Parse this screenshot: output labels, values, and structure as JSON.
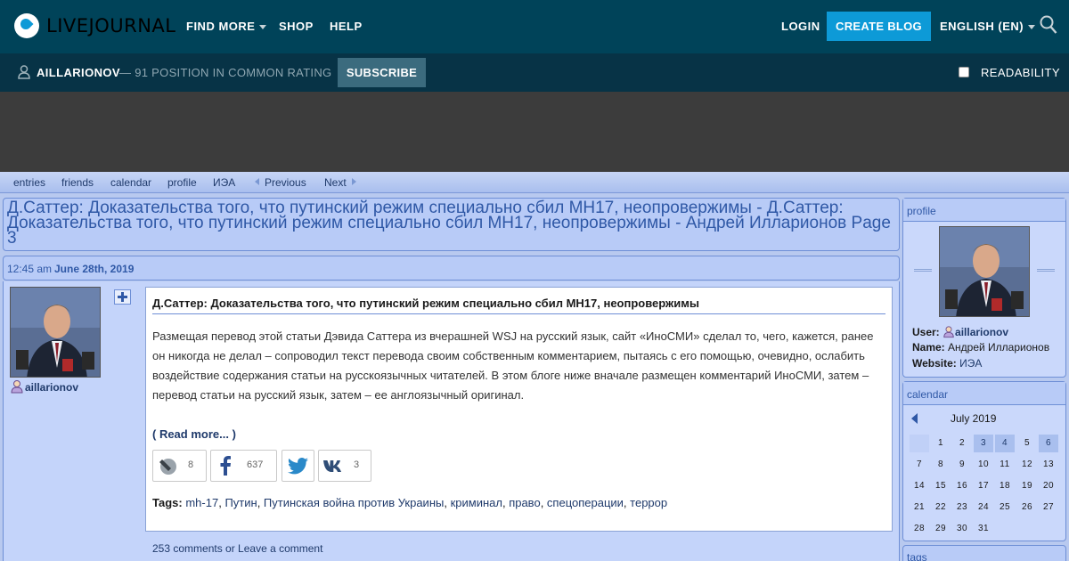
{
  "topbar": {
    "logo_text": "LIVEJOURNAL",
    "nav_find_more": "FIND MORE",
    "nav_shop": "SHOP",
    "nav_help": "HELP",
    "login": "LOGIN",
    "create_blog": "CREATE BLOG",
    "language": "ENGLISH (EN)"
  },
  "subbar": {
    "username": "AILLARIONOV",
    "rating": "— 91 POSITION IN COMMON RATING",
    "subscribe": "SUBSCRIBE",
    "readability": "READABILITY"
  },
  "journal_nav": {
    "entries": "entries",
    "friends": "friends",
    "calendar": "calendar",
    "profile": "profile",
    "iea": "ИЭА",
    "previous": "Previous",
    "next": "Next"
  },
  "page_title": "Д.Саттер: Доказательства того, что путинский режим специально сбил MH17, неопровержимы - Д.Саттер: Доказательства того, что путинский режим специально сбил MH17, неопровержимы - Андрей Илларионов Page 3",
  "entry": {
    "time": "12:45 am",
    "date": "June 28th, 2019",
    "author": "aillarionov",
    "subject": "Д.Саттер: Доказательства того, что путинский режим специально сбил MH17, неопровержимы",
    "body": "Размещая перевод этой статьи Дэвида Саттера из вчерашней WSJ на русский язык, сайт «ИноСМИ» сделал то, чего, кажется, ранее он никогда не делал – сопроводил текст перевода своим собственным комментарием, пытаясь с его помощью, очевидно, ослабить воздействие содержания статьи на русскоязычных читателей. В этом блоге ниже вначале размещен комментарий ИноСМИ, затем – перевод статьи на русский язык, затем – ее англоязычный оригинал.",
    "read_more": "( Read more... )",
    "share_lj_count": "8",
    "share_fb_count": "637",
    "share_vk_count": "3",
    "tags_label": "Tags:",
    "tags": [
      "mh-17",
      "Путин",
      "Путинская война против Украины",
      "криминал",
      "право",
      "спецоперации",
      "террор"
    ],
    "comments": "253 comments or Leave a comment"
  },
  "sidebar": {
    "profile_head": "profile",
    "user_label": "User:",
    "user_value": "aillarionov",
    "name_label": "Name:",
    "name_value": "Андрей Илларионов",
    "website_label": "Website:",
    "website_value": "ИЭА",
    "calendar_head": "calendar",
    "month": "July 2019",
    "days": [
      "1",
      "2",
      "3",
      "4",
      "5",
      "6",
      "7",
      "8",
      "9",
      "10",
      "11",
      "12",
      "13",
      "14",
      "15",
      "16",
      "17",
      "18",
      "19",
      "20",
      "21",
      "22",
      "23",
      "24",
      "25",
      "26",
      "27",
      "28",
      "29",
      "30",
      "31"
    ],
    "highlighted_days": [
      "3",
      "4",
      "6"
    ],
    "tags_head": "tags"
  }
}
